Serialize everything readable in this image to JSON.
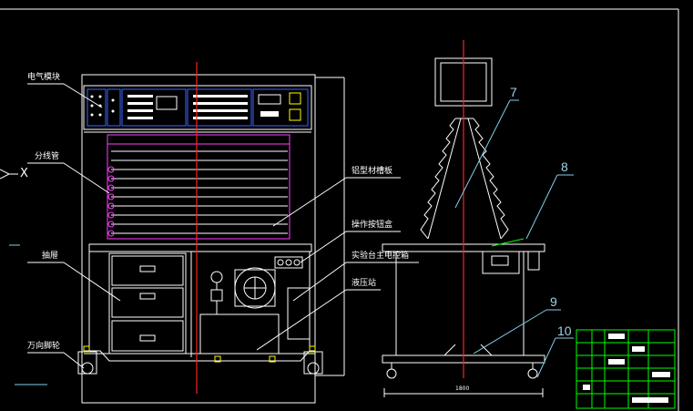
{
  "labels": {
    "electrical_module": "电气模块",
    "diverter_tube": "分线管",
    "drawers": "抽屉",
    "caster_wheels": "万向脚轮",
    "aluminum_panel": "铝型材槽板",
    "operation_box": "操作按钮盒",
    "main_controller": "实验台主电控箱",
    "hydraulic_station": "液压站"
  },
  "part_numbers": [
    "7",
    "8",
    "9",
    "10"
  ],
  "x_marker": "X",
  "dimension_text": "1800",
  "colors": {
    "background": "#000000",
    "outline": "#ffffff",
    "centerline": "#ff2020",
    "leader": "#7fd0e8",
    "module": "#3b63ff",
    "slots": "#ff40ff",
    "highlight": "#ffff00",
    "green": "#00ff00"
  }
}
